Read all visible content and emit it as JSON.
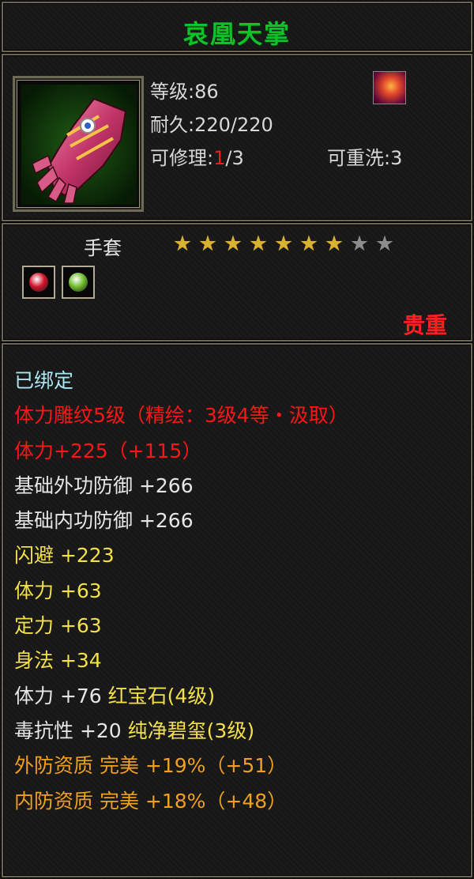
{
  "item": {
    "name": "哀凰天掌",
    "level_text": "等级:86",
    "durability_text": "耐久:220/220",
    "repair_prefix": "可修理:",
    "repair_current": "1",
    "repair_suffix": "/3",
    "rewash_text": "可重洗:3",
    "type": "手套",
    "stars_filled": 7,
    "stars_total": 9,
    "rarity": "贵重",
    "icon": "gauntlet-icon",
    "skill_icon": "flame-skill-icon"
  },
  "gems": [
    {
      "name": "ruby-socket-icon",
      "color": "#d2142a"
    },
    {
      "name": "jade-socket-icon",
      "color": "#6fbe2c"
    }
  ],
  "attributes": [
    {
      "text": "已绑定",
      "color": "bound"
    },
    {
      "text": "体力雕纹5级（精绘：3级4等・汲取）",
      "color": "red"
    },
    {
      "text": "体力+225（+115）",
      "color": "red"
    },
    {
      "text": "基础外功防御 +266",
      "color": "white"
    },
    {
      "text": "基础内功防御 +266",
      "color": "white"
    },
    {
      "text": "闪避 +223",
      "color": "yellow"
    },
    {
      "text": "体力 +63",
      "color": "yellow"
    },
    {
      "text": "定力 +63",
      "color": "yellow"
    },
    {
      "text": "身法 +34",
      "color": "yellow"
    },
    {
      "parts": [
        {
          "text": "体力 +76 ",
          "color": "white"
        },
        {
          "text": "红宝石(4级)",
          "color": "yellow"
        }
      ]
    },
    {
      "parts": [
        {
          "text": "毒抗性 +20 ",
          "color": "white"
        },
        {
          "text": "纯净碧玺(3级)",
          "color": "yellow"
        }
      ]
    },
    {
      "text": "外防资质  完美 +19%（+51）",
      "color": "orange"
    },
    {
      "text": "内防资质  完美 +18%（+48）",
      "color": "orange"
    }
  ],
  "colors": {
    "title_green": "#10c22a",
    "rarity_red": "#ff2020",
    "star_gold": "#d9b330",
    "star_gray": "#8c8c8c"
  }
}
